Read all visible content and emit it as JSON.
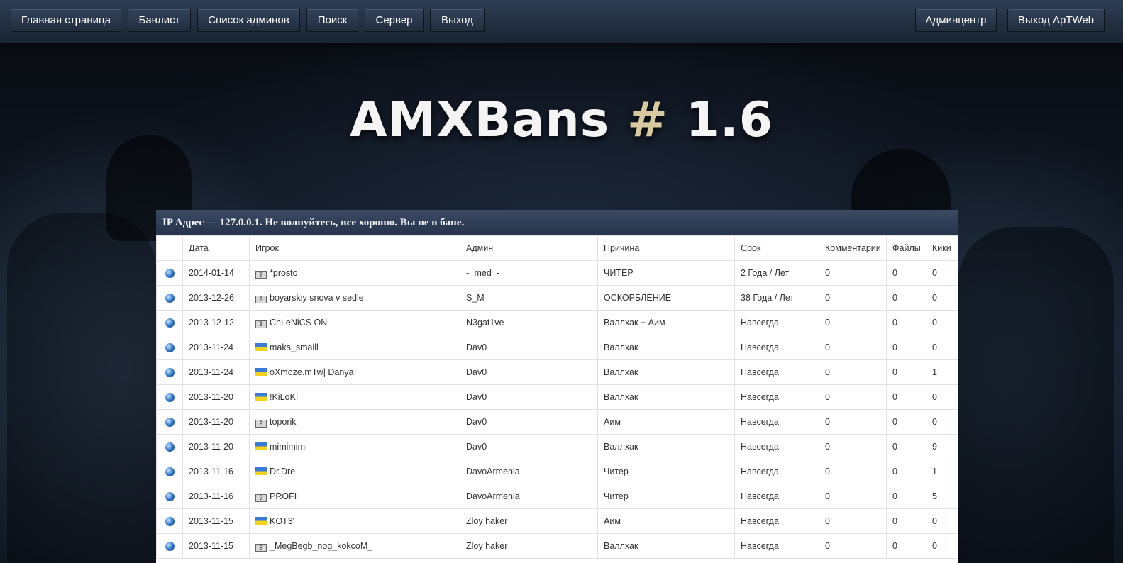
{
  "nav": {
    "left": [
      "Главная страница",
      "Банлист",
      "Список админов",
      "Поиск",
      "Сервер",
      "Выход"
    ],
    "right": [
      "Админцентр",
      "Выход ApTWeb"
    ]
  },
  "logo": {
    "main": "AMXBans ",
    "hash": "#",
    "version": " 1.6"
  },
  "notice": "IP Адрес — 127.0.0.1. Не волнуйтесь, все хорошо. Вы не в бане.",
  "columns": [
    "",
    "Дата",
    "Игрок",
    "Админ",
    "Причина",
    "Срок",
    "Комментарии",
    "Файлы",
    "Кики"
  ],
  "flag_unknown_glyph": "?",
  "colors": {
    "topbar": "#26334a",
    "panel_header": "#2f3e56",
    "hash_accent": "#d8c9a0"
  },
  "rows": [
    {
      "date": "2014-01-14",
      "flag": "unknown",
      "player": "*prosto",
      "admin": "-=med=-",
      "reason": "ЧИТЕР",
      "term": "2 Года / Лет",
      "comments": "0",
      "files": "0",
      "kicks": "0"
    },
    {
      "date": "2013-12-26",
      "flag": "unknown",
      "player": "boyarskiy snova v sedle",
      "admin": "S_M",
      "reason": "ОСКОРБЛЕНИЕ",
      "term": "38 Года / Лет",
      "comments": "0",
      "files": "0",
      "kicks": "0"
    },
    {
      "date": "2013-12-12",
      "flag": "unknown",
      "player": "ChLeNiCS ON",
      "admin": "N3gat1ve",
      "reason": "Валлхак + Аим",
      "term": "Навсегда",
      "comments": "0",
      "files": "0",
      "kicks": "0"
    },
    {
      "date": "2013-11-24",
      "flag": "ua",
      "player": "maks_smaill",
      "admin": "Dav0",
      "reason": "Валлхак",
      "term": "Навсегда",
      "comments": "0",
      "files": "0",
      "kicks": "0"
    },
    {
      "date": "2013-11-24",
      "flag": "ua",
      "player": "oXmoze.mTw| Danya",
      "admin": "Dav0",
      "reason": "Валлхак",
      "term": "Навсегда",
      "comments": "0",
      "files": "0",
      "kicks": "1"
    },
    {
      "date": "2013-11-20",
      "flag": "ua",
      "player": "!KiLoK!",
      "admin": "Dav0",
      "reason": "Валлхак",
      "term": "Навсегда",
      "comments": "0",
      "files": "0",
      "kicks": "0"
    },
    {
      "date": "2013-11-20",
      "flag": "unknown",
      "player": "toporik",
      "admin": "Dav0",
      "reason": "Аим",
      "term": "Навсегда",
      "comments": "0",
      "files": "0",
      "kicks": "0"
    },
    {
      "date": "2013-11-20",
      "flag": "ua",
      "player": "mimimimi",
      "admin": "Dav0",
      "reason": "Валлхак",
      "term": "Навсегда",
      "comments": "0",
      "files": "0",
      "kicks": "9"
    },
    {
      "date": "2013-11-16",
      "flag": "ua",
      "player": "Dr.Dre",
      "admin": "DavoArmenia",
      "reason": "Читер",
      "term": "Навсегда",
      "comments": "0",
      "files": "0",
      "kicks": "1"
    },
    {
      "date": "2013-11-16",
      "flag": "unknown",
      "player": "PROFI",
      "admin": "DavoArmenia",
      "reason": "Читер",
      "term": "Навсегда",
      "comments": "0",
      "files": "0",
      "kicks": "5"
    },
    {
      "date": "2013-11-15",
      "flag": "ua",
      "player": "KOT3'",
      "admin": "Zloy haker",
      "reason": "Аим",
      "term": "Навсегда",
      "comments": "0",
      "files": "0",
      "kicks": "0"
    },
    {
      "date": "2013-11-15",
      "flag": "unknown",
      "player": "_MegBegb_nog_kokcoM_",
      "admin": "Zloy haker",
      "reason": "Валлхак",
      "term": "Навсегда",
      "comments": "0",
      "files": "0",
      "kicks": "0"
    }
  ]
}
